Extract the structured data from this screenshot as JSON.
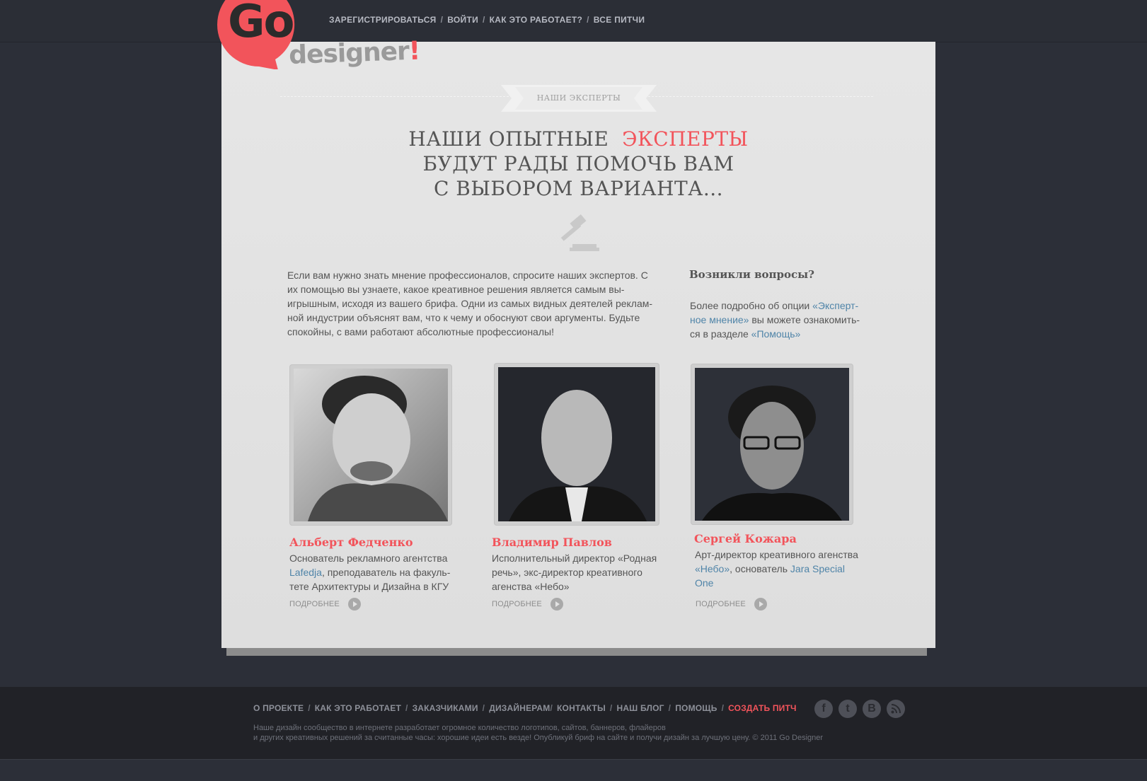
{
  "logo": {
    "go": "Go",
    "designer": "designer",
    "bang": "!"
  },
  "topnav": {
    "register": "ЗАРЕГИСТРИРОВАТЬСЯ",
    "login": "ВОЙТИ",
    "how": "КАК ЭТО РАБОТАЕТ?",
    "pitches": "ВСЕ ПИТЧИ",
    "sep": "/"
  },
  "ribbon": "НАШИ ЭКСПЕРТЫ",
  "headline": {
    "line1": "НАШИ ОПЫТНЫЕ",
    "accent": "ЭКСПЕРТЫ",
    "line2": "БУДУТ РАДЫ ПОМОЧЬ ВАМ",
    "line3": "С ВЫБОРОМ ВАРИАНТА..."
  },
  "intro": "Если вам нужно знать мнение профессионалов, спросите наших экспертов. С их помощью вы узнаете, какое креативное решения является самым вы-игрышным, исходя из вашего брифа. Одни из самых видных деятелей реклам-ной индустрии объяснят вам, что к чему и обоснуют свои аргументы. Будьте спокойны, с вами работают абсолютные профессионалы!",
  "faq": {
    "title": "Возникли вопросы?",
    "text_before": "Более подробно об опции ",
    "link1": "«Эксперт-ное мнение»",
    "text_middle": " вы можете ознакомить-ся в разделе ",
    "link2": "«Помощь»"
  },
  "experts": [
    {
      "name": "Альберт Федченко",
      "desc_before": "Основатель рекламного агентства ",
      "link": "Lafedja",
      "desc_after": ", преподаватель на факуль-тете Архитектуры и Дизайна в КГУ",
      "more": "ПОДРОБНЕЕ"
    },
    {
      "name": "Владимир Павлов",
      "desc": "Исполнительный директор «Родная речь», экс-директор креативного агенства «Небо»",
      "more": "ПОДРОБНЕЕ"
    },
    {
      "name": "Сергей Кожара",
      "desc_before": "Арт-директор креативного агенства ",
      "link1": "«Небо»",
      "desc_middle": ", основатель ",
      "link2": "Jara Special One",
      "more": "ПОДРОБНЕЕ"
    }
  ],
  "footer": {
    "nav": {
      "about": "О ПРОЕКТЕ",
      "how": "КАК ЭТО РАБОТАЕТ",
      "clients": "ЗАКАЗЧИКАМИ",
      "designers": "ДИЗАЙНЕРАМ",
      "contacts": "КОНТАКТЫ",
      "blog": "НАШ БЛОГ",
      "help": "ПОМОЩЬ",
      "create": "СОЗДАТЬ ПИТЧ",
      "sep": "/"
    },
    "social": {
      "facebook": "f",
      "twitter": "t",
      "vk": "B"
    },
    "line1": "Наше дизайн сообщество в интернете разработает огромное количество логотипов, сайтов, баннеров, флайеров",
    "line2": "и других креативных решений за считанные часы: хорошие идеи есть везде! Опубликуй бриф на сайте и получи дизайн за лучшую цену. © 2011 Go Designer"
  },
  "colors": {
    "accent": "#f2545b",
    "link": "#4f84a8",
    "bg_dark": "#2c2f38"
  }
}
